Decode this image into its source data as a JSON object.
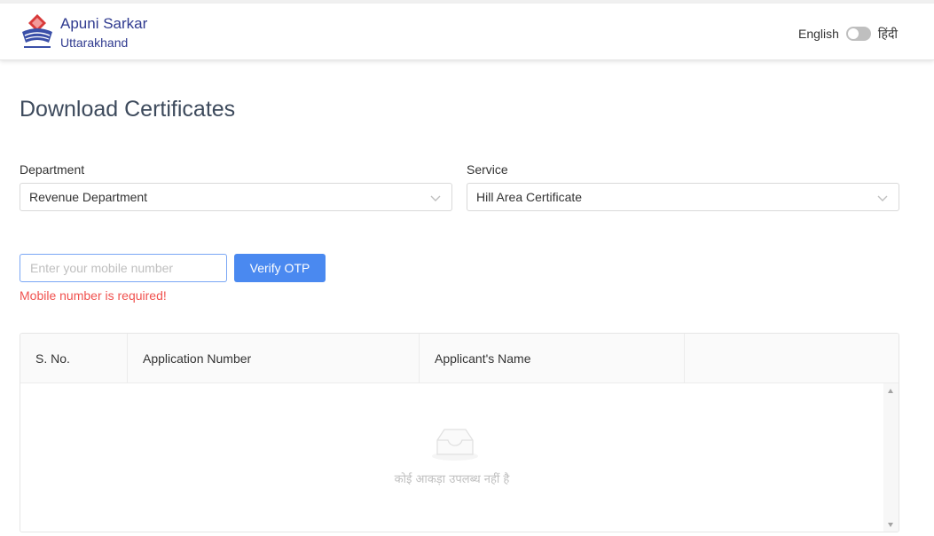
{
  "header": {
    "brand_title": "Apuni Sarkar",
    "brand_subtitle": "Uttarakhand",
    "lang_english": "English",
    "lang_hindi": "हिंदी",
    "language_toggle_on": false
  },
  "page": {
    "title": "Download Certificates"
  },
  "filters": {
    "department_label": "Department",
    "department_value": "Revenue Department",
    "service_label": "Service",
    "service_value": "Hill Area Certificate"
  },
  "otp": {
    "mobile_placeholder": "Enter your mobile number",
    "mobile_value": "",
    "verify_label": "Verify OTP",
    "error_text": "Mobile number is required!"
  },
  "table": {
    "columns": [
      "S. No.",
      "Application Number",
      "Applicant's Name",
      ""
    ],
    "rows": [],
    "empty_text": "कोई आकड़ा उपलब्ध नहीं है"
  },
  "colors": {
    "brand": "#2f3a8f",
    "primary_button": "#4a89f0",
    "error": "#f0524f",
    "input_focus_border": "#7aa7f5"
  },
  "icons": [
    "uttarakhand-emblem-icon",
    "chevron-down-icon",
    "empty-inbox-icon",
    "scroll-up-arrow-icon",
    "scroll-down-arrow-icon"
  ]
}
